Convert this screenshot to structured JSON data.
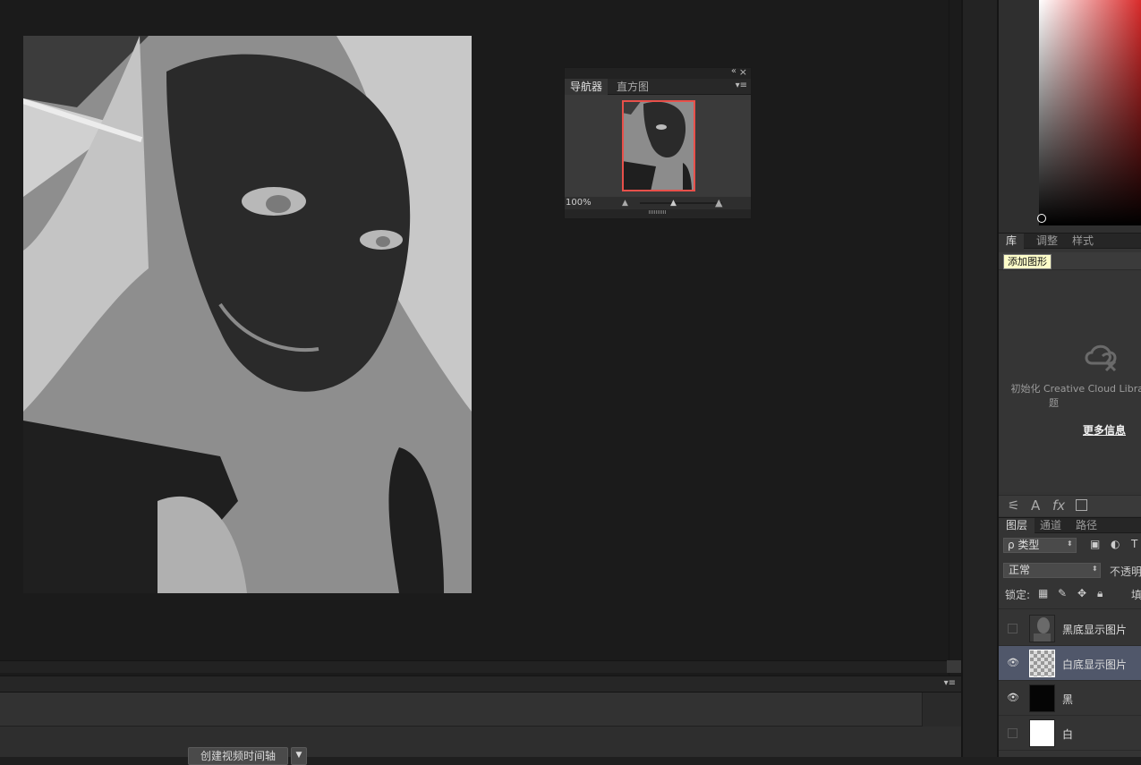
{
  "colors": {
    "accent_red": "#e8504a",
    "selected_layer": "#50576a",
    "tooltip_bg": "#fdfdc9"
  },
  "navigator": {
    "tabs": [
      "导航器",
      "直方图"
    ],
    "zoom": "100%"
  },
  "library": {
    "tabs": [
      "库",
      "调整",
      "样式"
    ],
    "tooltip": "添加图形",
    "cc_message_line1": "初始化 Creative Cloud Librar",
    "cc_message_line2": "题",
    "more_info": "更多信息"
  },
  "layers_panel": {
    "tabs": [
      "图层",
      "通道",
      "路径"
    ],
    "filter_kind": "ρ 类型",
    "blend_mode": "正常",
    "opacity_label": "不透明",
    "lock_label": "锁定:",
    "fill_label": "填",
    "layers": [
      {
        "name": "黑底显示图片",
        "visible": false,
        "selected": false
      },
      {
        "name": "白底显示图片",
        "visible": true,
        "selected": true
      },
      {
        "name": "黑",
        "visible": true,
        "selected": false
      },
      {
        "name": "白",
        "visible": false,
        "selected": false
      }
    ]
  },
  "timeline": {
    "create_button": "创建视频时间轴"
  }
}
